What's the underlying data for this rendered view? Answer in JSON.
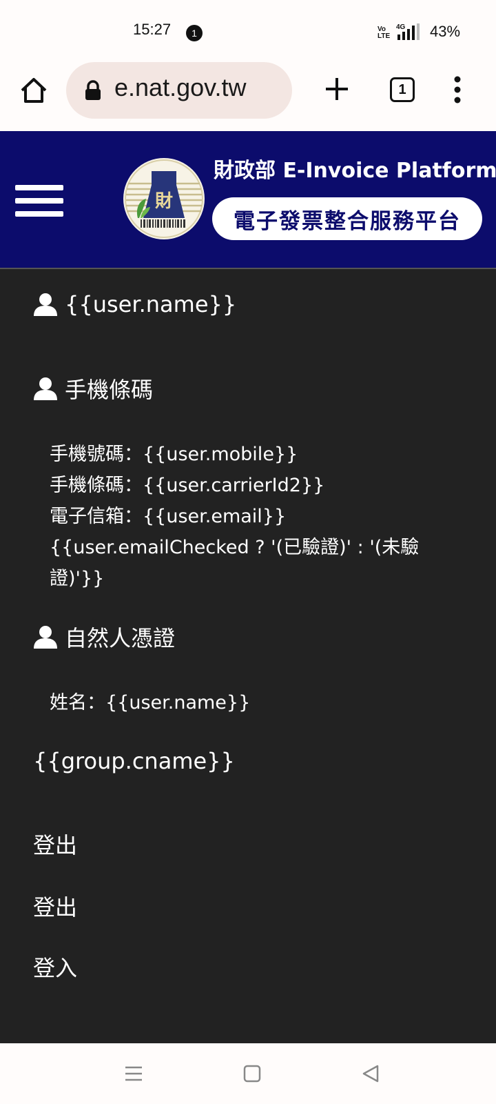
{
  "status_bar": {
    "time": "15:27",
    "notification_count": "1",
    "volte": "Vo LTE",
    "network": "4G",
    "battery": "43%"
  },
  "browser": {
    "url": "e.nat.gov.tw",
    "tab_count": "1"
  },
  "header": {
    "title": "財政部 E-Invoice Platform",
    "subtitle": "電子發票整合服務平台"
  },
  "menu": {
    "user_name": "{{user.name}}",
    "mobile_barcode": {
      "title": "手機條碼",
      "lines": [
        "手機號碼：{{user.mobile}}",
        "手機條碼：{{user.carrierId2}}",
        "電子信箱：{{user.email}}",
        "{{user.emailChecked ? '(已驗證)' : '(未驗證)'}}"
      ]
    },
    "citizen_cert": {
      "title": "自然人憑證",
      "lines": [
        "姓名：{{user.name}}"
      ]
    },
    "group": "{{group.cname}}",
    "logout_1": "登出",
    "logout_2": "登出",
    "login": "登入"
  },
  "colors": {
    "header_bg": "#0c0c6c",
    "menu_bg": "#222222",
    "system_bar_bg": "#fffcfb"
  }
}
